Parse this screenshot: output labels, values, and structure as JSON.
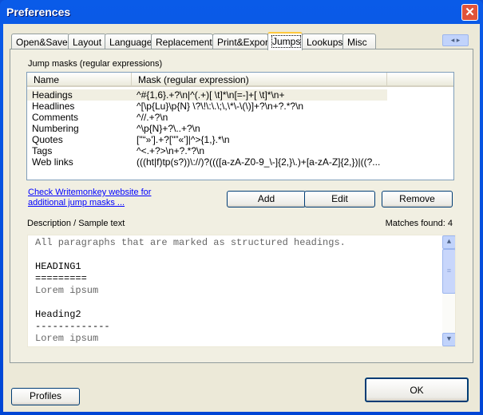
{
  "window": {
    "title": "Preferences",
    "close_icon": "close-icon"
  },
  "tabs": [
    "Open&Save",
    "Layout",
    "Language",
    "Replacements",
    "Print&Export",
    "Jumps",
    "Lookups",
    "Misc"
  ],
  "active_tab": "Jumps",
  "group_label": "Jump masks (regular expressions)",
  "list": {
    "columns": [
      "Name",
      "Mask (regular expression)"
    ],
    "rows": [
      {
        "name": "Headings",
        "mask": "^#{1,6}.+?\\n|^(.+)[ \\t]*\\n[=-]+[ \\t]*\\n+"
      },
      {
        "name": "Headlines",
        "mask": "^[\\p{Lu}\\p{N} \\?\\!\\:\\.\\;\\,\\*\\-\\(\\)]+?\\n+?.*?\\n"
      },
      {
        "name": "Comments",
        "mask": "^//.+?\\n"
      },
      {
        "name": "Numbering",
        "mask": "^\\p{N}+?\\..+?\\n"
      },
      {
        "name": "Quotes",
        "mask": "[\"“»'].+?[\"”«']|^>{1,}.*\\n"
      },
      {
        "name": "Tags",
        "mask": "^<.+?>\\n+?.*?\\n"
      },
      {
        "name": "Web links",
        "mask": "(((ht|f)tp(s?))\\://)?((([a-zA-Z0-9_\\-]{2,}\\.)+[a-zA-Z]{2,})|((?..."
      }
    ]
  },
  "link_text_1": "Check Writemonkey website for",
  "link_text_2": "additional jump masks ...",
  "buttons": {
    "add": "Add",
    "edit": "Edit",
    "remove": "Remove",
    "profiles": "Profiles",
    "ok": "OK"
  },
  "description_label": "Description / Sample text",
  "matches_label": "Matches found: 4",
  "sample_lines": [
    "All paragraphs that are marked as structured headings.",
    "",
    "HEADING1",
    "=========",
    "Lorem ipsum",
    "",
    "Heading2",
    "-------------",
    "Lorem ipsum"
  ]
}
